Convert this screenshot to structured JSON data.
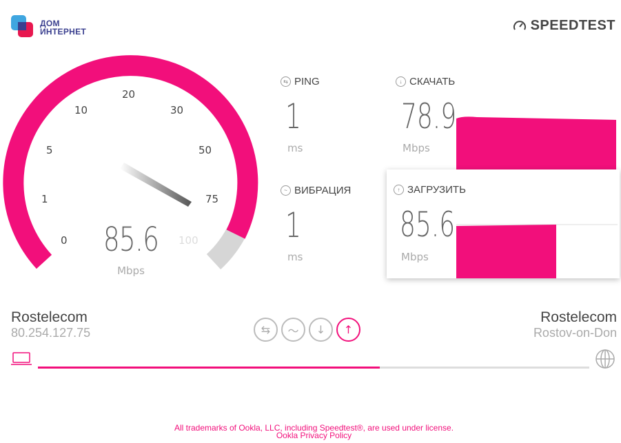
{
  "brand": {
    "provider_logo_text_line1": "ДОМ",
    "provider_logo_text_line2": "ИНТЕРНЕТ",
    "speedtest_title": "SPEEDTEST",
    "accent_color": "#f20f7b"
  },
  "gauge": {
    "ticks": [
      "0",
      "1",
      "5",
      "10",
      "20",
      "30",
      "50",
      "75",
      "100"
    ],
    "value": "85.6",
    "unit": "Mbps"
  },
  "stats": {
    "ping": {
      "label": "PING",
      "value": "1",
      "unit": "ms",
      "icon": "ping-icon"
    },
    "jitter": {
      "label": "ВИБРАЦИЯ",
      "value": "1",
      "unit": "ms",
      "icon": "jitter-icon"
    },
    "download": {
      "label": "СКАЧАТЬ",
      "value": "78.9",
      "unit": "Mbps",
      "icon": "download-icon"
    },
    "upload": {
      "label": "ЗАГРУЗИТЬ",
      "value": "85.6",
      "unit": "Mbps",
      "icon": "upload-icon"
    }
  },
  "client": {
    "isp": "Rostelecom",
    "ip": "80.254.127.75"
  },
  "server": {
    "name": "Rostelecom",
    "location": "Rostov-on-Don"
  },
  "progress": {
    "fraction": 0.62
  },
  "footer": {
    "trademark": "All trademarks of Ookla, LLC, including Speedtest®, are used under license.",
    "privacy_link": "Ookla Privacy Policy"
  }
}
